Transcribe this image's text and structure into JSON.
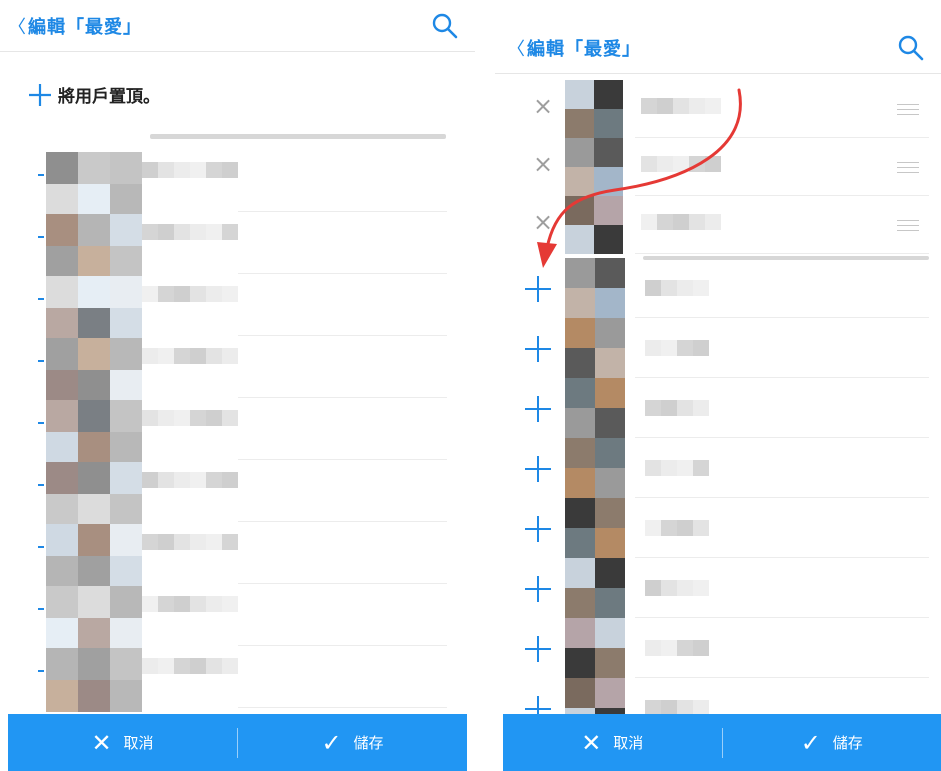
{
  "left_screen": {
    "header": {
      "back_glyph": "〈",
      "title": "編輯「最愛」",
      "search_icon": "search-icon"
    },
    "pin_label": "將用戶置頂。",
    "footer": {
      "cancel_label": "取消",
      "save_label": "儲存"
    }
  },
  "right_screen": {
    "header": {
      "back_glyph": "〈",
      "title": "編輯「最愛」",
      "search_icon": "search-icon"
    },
    "footer": {
      "cancel_label": "取消",
      "save_label": "儲存"
    }
  },
  "colors": {
    "accent": "#2196f3",
    "title_blue": "#1e88e5",
    "annotation_arrow": "#e53935"
  }
}
